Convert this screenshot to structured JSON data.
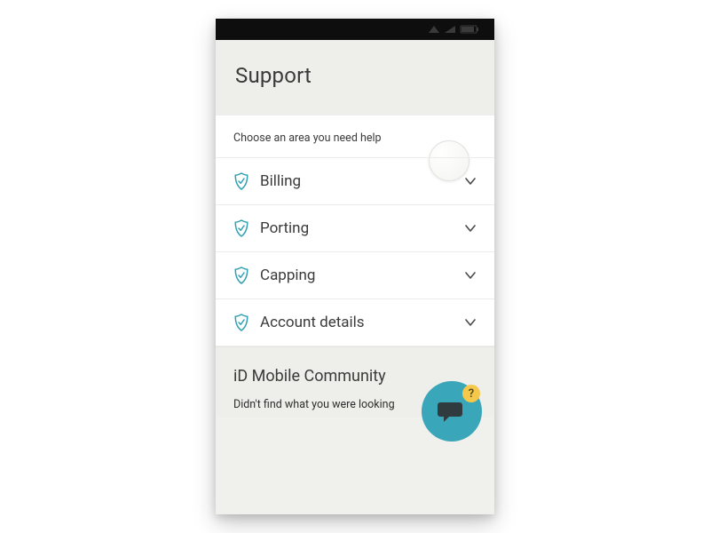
{
  "header": {
    "title": "Support"
  },
  "prompt": "Choose an area you need help",
  "categories": [
    {
      "label": "Billing"
    },
    {
      "label": "Porting"
    },
    {
      "label": "Capping"
    },
    {
      "label": "Account details"
    }
  ],
  "community": {
    "title": "iD Mobile Community",
    "subtitle": "Didn't find what you were looking"
  },
  "chat_badge": "?",
  "colors": {
    "shield": "#2f9fb3",
    "chevron": "#4a4a4a",
    "fab": "#3aa6b9",
    "badge": "#f4c84a"
  }
}
